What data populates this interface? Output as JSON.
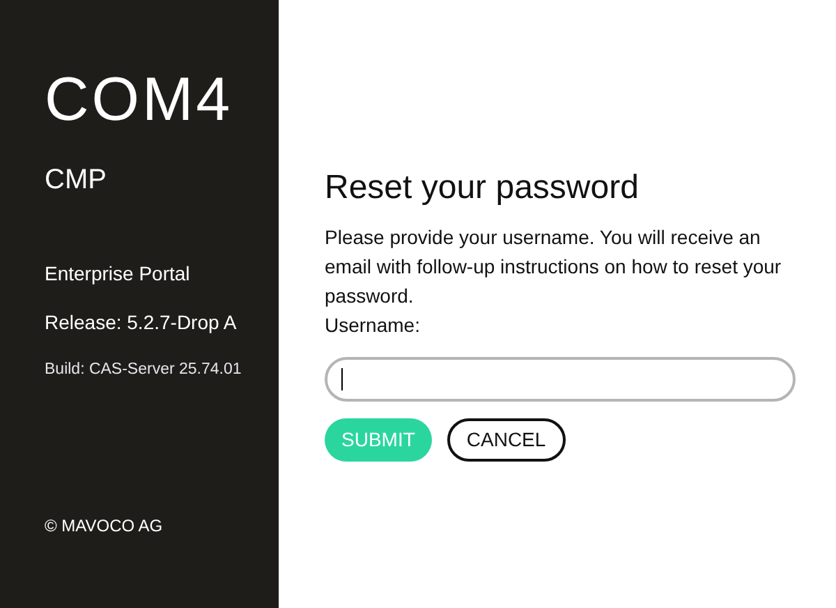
{
  "sidebar": {
    "logo": "COM4",
    "product": "CMP",
    "portal": "Enterprise Portal",
    "release": "Release: 5.2.7-Drop A",
    "build": "Build: CAS-Server 25.74.01",
    "copyright": "© MAVOCO AG"
  },
  "form": {
    "title": "Reset your password",
    "instructions": "Please provide your username. You will receive an email with follow-up instructions on how to reset your password.",
    "username_label": "Username:",
    "buttons": [
      {
        "label": "SUBMIT",
        "kind": "primary"
      },
      {
        "label": "CANCEL",
        "kind": "secondary"
      }
    ]
  }
}
